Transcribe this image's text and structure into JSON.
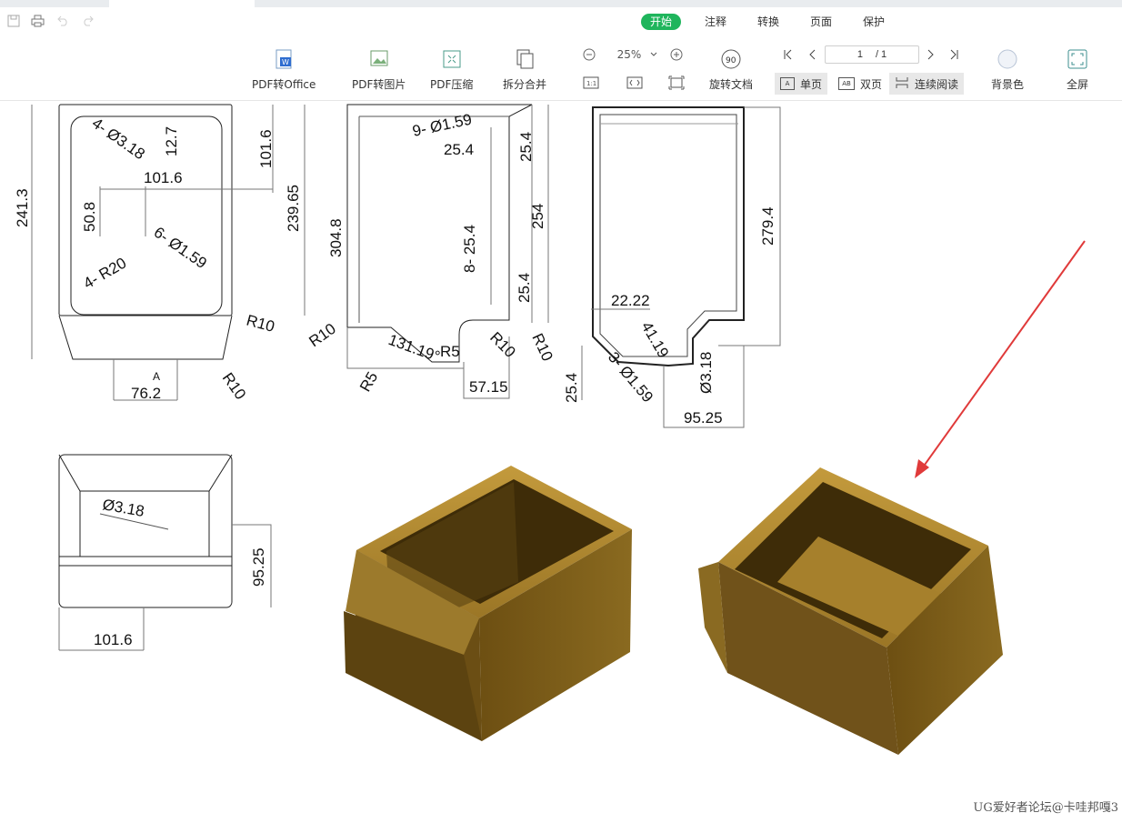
{
  "toolbar": {
    "tabs": [
      {
        "label": "开始",
        "active": true
      },
      {
        "label": "注释",
        "active": false
      },
      {
        "label": "转换",
        "active": false
      },
      {
        "label": "页面",
        "active": false
      },
      {
        "label": "保护",
        "active": false
      }
    ],
    "tools": {
      "pdf_to_office": "PDF转Office",
      "pdf_to_image": "PDF转图片",
      "pdf_compress": "PDF压缩",
      "split_merge": "拆分合并",
      "rotate_doc": "旋转文档",
      "single_page": "单页",
      "double_page": "双页",
      "continuous": "连续阅读",
      "background": "背景色",
      "fullscreen": "全屏"
    },
    "zoom": "25%",
    "page_current": "1",
    "page_total": "/ 1",
    "rotate_badge": "90",
    "fit_label": "1:1"
  },
  "drawing": {
    "view1_dims": [
      "241.3",
      "239.65",
      "101.6",
      "12.7",
      "101.6",
      "50.8",
      "4- Ø3.18",
      "6- Ø1.59",
      "4- R20",
      "R10",
      "R10",
      "76.2",
      "A"
    ],
    "view2_dims": [
      "304.8",
      "9- Ø1.59",
      "25.4",
      "25.4",
      "254",
      "8- 25.4",
      "25.4",
      "R10",
      "131.19°",
      "R5",
      "R10",
      "R10",
      "R5",
      "57.15"
    ],
    "view3_dims": [
      "279.4",
      "22.22",
      "41.19",
      "3- Ø1.59",
      "Ø3.18",
      "25.4",
      "95.25"
    ],
    "view4_dims": [
      "Ø3.18",
      "95.25",
      "101.6"
    ]
  },
  "watermark": "UG爱好者论坛@卡哇邦嘎3",
  "colors": {
    "accent": "#1fb55c",
    "model_body": "#7a5a16",
    "model_light": "#b08a2e",
    "arrow": "#e03a3a"
  }
}
